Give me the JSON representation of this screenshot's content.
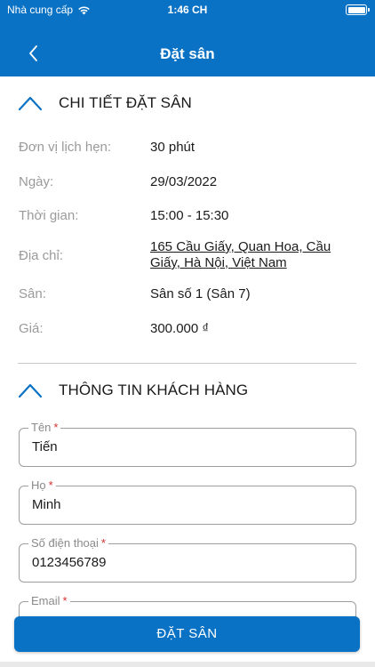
{
  "status_bar": {
    "carrier": "Nhà cung cấp",
    "time": "1:46 CH",
    "icons": [
      "wifi-icon",
      "battery-icon"
    ]
  },
  "nav": {
    "title": "Đặt sân",
    "back_icon": "chevron-left-icon"
  },
  "booking_section": {
    "title": "CHI TIẾT ĐẶT SÂN",
    "toggle_icon": "chevron-up-icon",
    "rows": [
      {
        "label": "Đơn vị lịch hẹn:",
        "value": "30 phút"
      },
      {
        "label": "Ngày:",
        "value": "29/03/2022"
      },
      {
        "label": "Thời gian:",
        "value": "15:00 - 15:30"
      },
      {
        "label": "Địa chỉ:",
        "value": "165 Cầu Giấy, Quan Hoa, Cầu Giấy, Hà Nội, Việt Nam"
      },
      {
        "label": "Sân:",
        "value": "Sân số 1 (Sân 7)"
      },
      {
        "label": "Giá:",
        "value": "300.000 ₫"
      }
    ]
  },
  "customer_section": {
    "title": "THÔNG TIN KHÁCH HÀNG",
    "toggle_icon": "chevron-up-icon",
    "fields": [
      {
        "label": "Tên",
        "required_mark": "*",
        "value": "Tiến"
      },
      {
        "label": "Họ",
        "required_mark": "*",
        "value": "Minh"
      },
      {
        "label": "Số điện thoại",
        "required_mark": "*",
        "value": "0123456789"
      },
      {
        "label": "Email",
        "required_mark": "*",
        "value": ""
      }
    ]
  },
  "submit_label": "ĐẶT SÂN",
  "colors": {
    "primary": "#0a72c4",
    "required": "#d32f2f",
    "label_gray": "#9a9a9a"
  }
}
